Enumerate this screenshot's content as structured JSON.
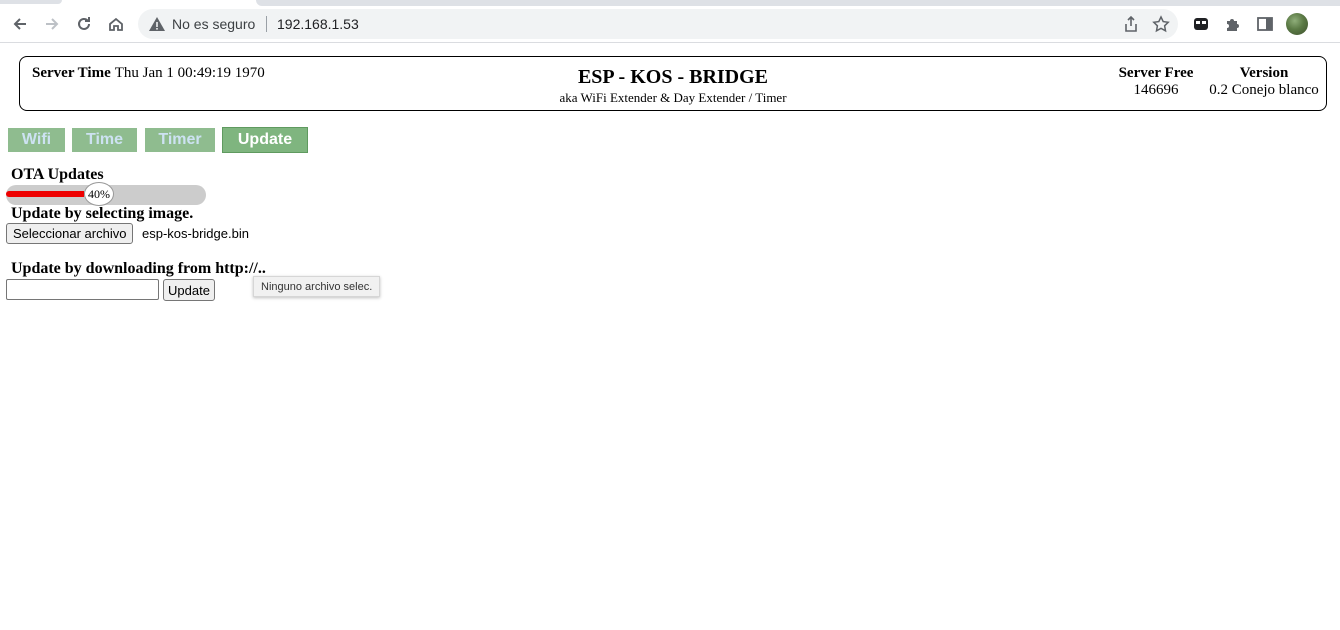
{
  "browser": {
    "insecure_label": "No es seguro",
    "url": "192.168.1.53"
  },
  "header": {
    "server_time_label": "Server Time",
    "server_time_value": "Thu Jan 1 00:49:19 1970",
    "title": "ESP - KOS - BRIDGE",
    "subtitle": "aka WiFi Extender & Day Extender / Timer",
    "server_free_label": "Server Free",
    "server_free_value": "146696",
    "version_label": "Version",
    "version_value": "0.2 Conejo blanco"
  },
  "tabs": [
    {
      "label": "Wifi",
      "active": false
    },
    {
      "label": "Time",
      "active": false
    },
    {
      "label": "Timer",
      "active": false
    },
    {
      "label": "Update",
      "active": true
    }
  ],
  "ota": {
    "heading": "OTA Updates",
    "progress_percent": 40,
    "progress_label": "40%",
    "select_heading": "Update by selecting image.",
    "file_button_label": "Seleccionar archivo",
    "file_name": "esp-kos-bridge.bin",
    "download_heading": "Update by downloading from http://..",
    "url_value": "",
    "update_button_label": "Update",
    "tooltip": "Ninguno archivo selec."
  },
  "colors": {
    "tab_bg": "#8fbc8f",
    "tab_text": "#cde2f2",
    "progress_fill": "#ee0000"
  }
}
